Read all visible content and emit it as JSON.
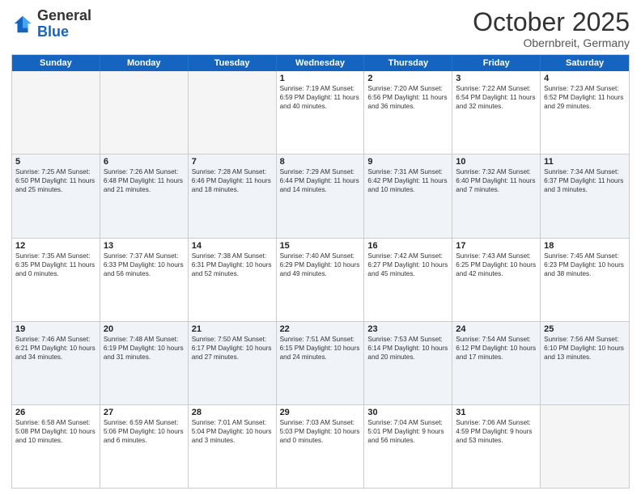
{
  "header": {
    "logo_general": "General",
    "logo_blue": "Blue",
    "month": "October 2025",
    "location": "Obernbreit, Germany"
  },
  "days_of_week": [
    "Sunday",
    "Monday",
    "Tuesday",
    "Wednesday",
    "Thursday",
    "Friday",
    "Saturday"
  ],
  "rows": [
    [
      {
        "num": "",
        "info": ""
      },
      {
        "num": "",
        "info": ""
      },
      {
        "num": "",
        "info": ""
      },
      {
        "num": "1",
        "info": "Sunrise: 7:19 AM\nSunset: 6:59 PM\nDaylight: 11 hours\nand 40 minutes."
      },
      {
        "num": "2",
        "info": "Sunrise: 7:20 AM\nSunset: 6:56 PM\nDaylight: 11 hours\nand 36 minutes."
      },
      {
        "num": "3",
        "info": "Sunrise: 7:22 AM\nSunset: 6:54 PM\nDaylight: 11 hours\nand 32 minutes."
      },
      {
        "num": "4",
        "info": "Sunrise: 7:23 AM\nSunset: 6:52 PM\nDaylight: 11 hours\nand 29 minutes."
      }
    ],
    [
      {
        "num": "5",
        "info": "Sunrise: 7:25 AM\nSunset: 6:50 PM\nDaylight: 11 hours\nand 25 minutes."
      },
      {
        "num": "6",
        "info": "Sunrise: 7:26 AM\nSunset: 6:48 PM\nDaylight: 11 hours\nand 21 minutes."
      },
      {
        "num": "7",
        "info": "Sunrise: 7:28 AM\nSunset: 6:46 PM\nDaylight: 11 hours\nand 18 minutes."
      },
      {
        "num": "8",
        "info": "Sunrise: 7:29 AM\nSunset: 6:44 PM\nDaylight: 11 hours\nand 14 minutes."
      },
      {
        "num": "9",
        "info": "Sunrise: 7:31 AM\nSunset: 6:42 PM\nDaylight: 11 hours\nand 10 minutes."
      },
      {
        "num": "10",
        "info": "Sunrise: 7:32 AM\nSunset: 6:40 PM\nDaylight: 11 hours\nand 7 minutes."
      },
      {
        "num": "11",
        "info": "Sunrise: 7:34 AM\nSunset: 6:37 PM\nDaylight: 11 hours\nand 3 minutes."
      }
    ],
    [
      {
        "num": "12",
        "info": "Sunrise: 7:35 AM\nSunset: 6:35 PM\nDaylight: 11 hours\nand 0 minutes."
      },
      {
        "num": "13",
        "info": "Sunrise: 7:37 AM\nSunset: 6:33 PM\nDaylight: 10 hours\nand 56 minutes."
      },
      {
        "num": "14",
        "info": "Sunrise: 7:38 AM\nSunset: 6:31 PM\nDaylight: 10 hours\nand 52 minutes."
      },
      {
        "num": "15",
        "info": "Sunrise: 7:40 AM\nSunset: 6:29 PM\nDaylight: 10 hours\nand 49 minutes."
      },
      {
        "num": "16",
        "info": "Sunrise: 7:42 AM\nSunset: 6:27 PM\nDaylight: 10 hours\nand 45 minutes."
      },
      {
        "num": "17",
        "info": "Sunrise: 7:43 AM\nSunset: 6:25 PM\nDaylight: 10 hours\nand 42 minutes."
      },
      {
        "num": "18",
        "info": "Sunrise: 7:45 AM\nSunset: 6:23 PM\nDaylight: 10 hours\nand 38 minutes."
      }
    ],
    [
      {
        "num": "19",
        "info": "Sunrise: 7:46 AM\nSunset: 6:21 PM\nDaylight: 10 hours\nand 34 minutes."
      },
      {
        "num": "20",
        "info": "Sunrise: 7:48 AM\nSunset: 6:19 PM\nDaylight: 10 hours\nand 31 minutes."
      },
      {
        "num": "21",
        "info": "Sunrise: 7:50 AM\nSunset: 6:17 PM\nDaylight: 10 hours\nand 27 minutes."
      },
      {
        "num": "22",
        "info": "Sunrise: 7:51 AM\nSunset: 6:15 PM\nDaylight: 10 hours\nand 24 minutes."
      },
      {
        "num": "23",
        "info": "Sunrise: 7:53 AM\nSunset: 6:14 PM\nDaylight: 10 hours\nand 20 minutes."
      },
      {
        "num": "24",
        "info": "Sunrise: 7:54 AM\nSunset: 6:12 PM\nDaylight: 10 hours\nand 17 minutes."
      },
      {
        "num": "25",
        "info": "Sunrise: 7:56 AM\nSunset: 6:10 PM\nDaylight: 10 hours\nand 13 minutes."
      }
    ],
    [
      {
        "num": "26",
        "info": "Sunrise: 6:58 AM\nSunset: 5:08 PM\nDaylight: 10 hours\nand 10 minutes."
      },
      {
        "num": "27",
        "info": "Sunrise: 6:59 AM\nSunset: 5:06 PM\nDaylight: 10 hours\nand 6 minutes."
      },
      {
        "num": "28",
        "info": "Sunrise: 7:01 AM\nSunset: 5:04 PM\nDaylight: 10 hours\nand 3 minutes."
      },
      {
        "num": "29",
        "info": "Sunrise: 7:03 AM\nSunset: 5:03 PM\nDaylight: 10 hours\nand 0 minutes."
      },
      {
        "num": "30",
        "info": "Sunrise: 7:04 AM\nSunset: 5:01 PM\nDaylight: 9 hours\nand 56 minutes."
      },
      {
        "num": "31",
        "info": "Sunrise: 7:06 AM\nSunset: 4:59 PM\nDaylight: 9 hours\nand 53 minutes."
      },
      {
        "num": "",
        "info": ""
      }
    ]
  ],
  "alt_rows": [
    1,
    3
  ]
}
